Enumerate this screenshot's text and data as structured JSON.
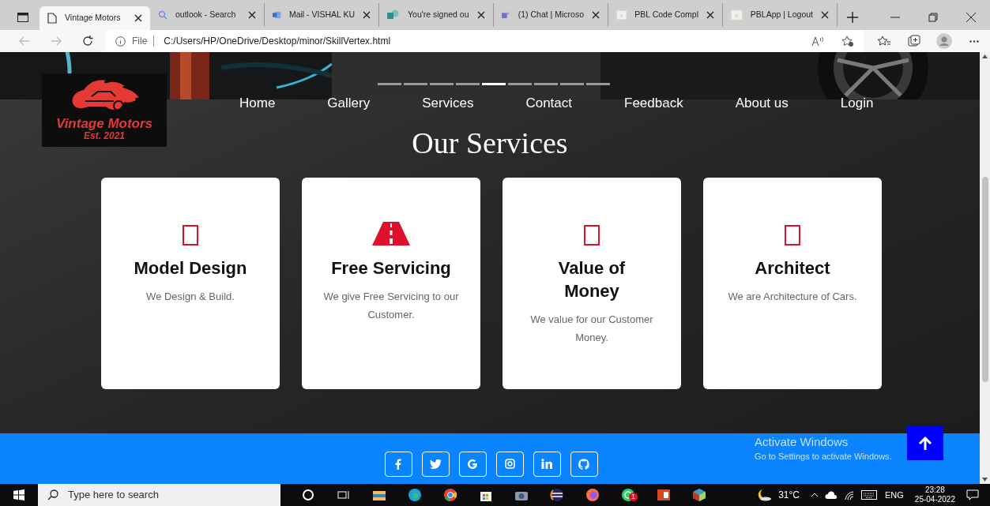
{
  "browser": {
    "tabs": [
      {
        "title": "Vintage Motors",
        "selected": true
      },
      {
        "title": "outlook - Search",
        "selected": false
      },
      {
        "title": "Mail - VISHAL KU",
        "selected": false
      },
      {
        "title": "You're signed ou",
        "selected": false
      },
      {
        "title": "(1) Chat | Microso",
        "selected": false
      },
      {
        "title": "PBL Code Compl",
        "selected": false
      },
      {
        "title": "PBLApp | Logout",
        "selected": false
      }
    ],
    "address": {
      "scheme": "File",
      "url": "C:/Users/HP/OneDrive/Desktop/minor/SkillVertex.html"
    }
  },
  "page": {
    "logo": {
      "title": "Vintage Motors",
      "subtitle": "Est. 2021"
    },
    "carousel_indicators": [
      {
        "selected": false
      },
      {
        "selected": false
      },
      {
        "selected": false
      },
      {
        "selected": false
      },
      {
        "selected": true
      },
      {
        "selected": false
      },
      {
        "selected": false
      },
      {
        "selected": false
      },
      {
        "selected": false
      }
    ],
    "nav": [
      "Home",
      "Gallery",
      "Services",
      "Contact",
      "Feedback",
      "About us",
      "Login"
    ],
    "heading": "Our Services",
    "cards": [
      {
        "title": "Model Design",
        "description": "We Design & Build."
      },
      {
        "title": "Free Servicing",
        "description": "We give Free Servicing to our Customer."
      },
      {
        "title": "Value of Money",
        "description": "We value for our Customer Money."
      },
      {
        "title": "Architect",
        "description": "We are Architecture of Cars."
      }
    ],
    "activation_notice": {
      "title": "Activate Windows",
      "text": "Go to Settings to activate Windows."
    }
  },
  "taskbar": {
    "search_placeholder": "Type here to search",
    "whatsapp_badge": "1",
    "temperature": "31°C",
    "language": "ENG",
    "time": "23:28",
    "date": "25-04-2022"
  }
}
